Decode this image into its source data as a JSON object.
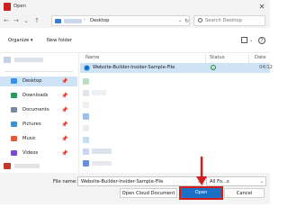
{
  "window": {
    "title": "Open",
    "close_glyph": "✕"
  },
  "address_bar": {
    "back": "←",
    "forward": "→",
    "dropdown": "⌄",
    "up": "↑",
    "breadcrumb_separator": "›",
    "path": "Desktop",
    "refresh": "↻",
    "search_placeholder": "Search Desktop"
  },
  "toolbar": {
    "organize_label": "Organize ▾",
    "new_folder_label": "New folder",
    "help_glyph": "?"
  },
  "sidebar": {
    "items": [
      {
        "label": "Desktop",
        "icon": "desktop-icon",
        "color": "#3a8ee6",
        "pinned": true,
        "selected": true
      },
      {
        "label": "Downloads",
        "icon": "downloads-icon",
        "color": "#2a9a5a",
        "pinned": true
      },
      {
        "label": "Documents",
        "icon": "documents-icon",
        "color": "#7a8aa0",
        "pinned": true
      },
      {
        "label": "Pictures",
        "icon": "pictures-icon",
        "color": "#3f8fd2",
        "pinned": true
      },
      {
        "label": "Music",
        "icon": "music-icon",
        "color": "#e05a3a",
        "pinned": true
      },
      {
        "label": "Videos",
        "icon": "videos-icon",
        "color": "#7a4ad0",
        "pinned": true
      }
    ],
    "pin_glyph": "📌"
  },
  "file_list": {
    "columns": {
      "name": "Name",
      "status": "Status",
      "date": "Date"
    },
    "selected_file": {
      "name": "Website-Builder-Insider-Sample-File",
      "status_glyph": "✓",
      "date": "04/12"
    }
  },
  "bottom": {
    "file_name_label": "File name:",
    "file_name_value": "Website-Builder-Insider-Sample-File",
    "file_type_value": "All Fo...s",
    "dropdown": "⌄",
    "open_cloud_label": "Open Cloud Document",
    "open_label": "Open",
    "cancel_label": "Cancel"
  },
  "colors": {
    "accent": "#1b6fc4",
    "selection": "#cfe3f7",
    "annotation": "#d21d1d",
    "app_icon": "#cc1f1f"
  }
}
